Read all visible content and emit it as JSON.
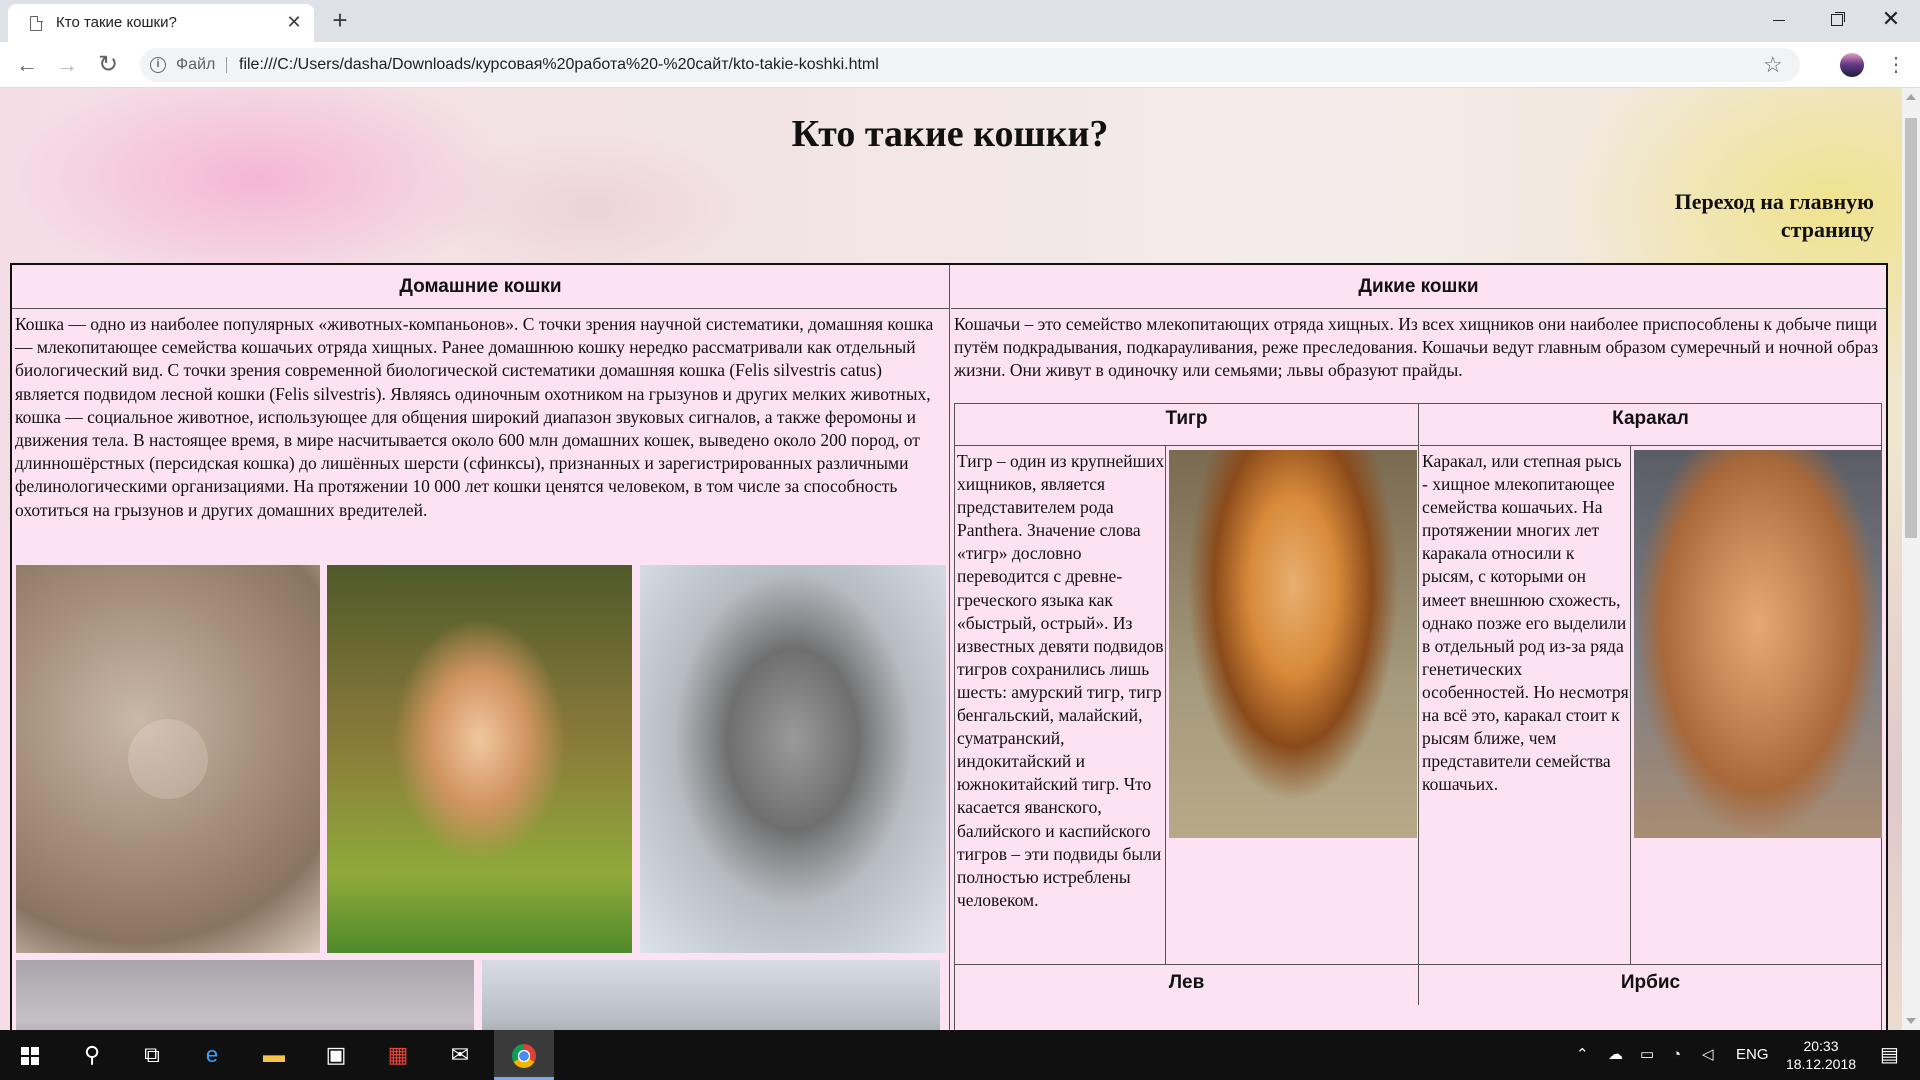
{
  "browser": {
    "tab_title": "Кто такие кошки?",
    "tab_close": "✕",
    "new_tab": "+",
    "scheme_label": "Файл",
    "url": "file:///C:/Users/dasha/Downloads/курсовая%20работа%20-%20сайт/kto-takie-koshki.html",
    "icons": [
      "document-icon",
      "back-icon",
      "forward-icon",
      "reload-icon",
      "info-icon",
      "star-icon",
      "profile-avatar",
      "menu-icon"
    ]
  },
  "page": {
    "title": "Кто такие кошки?",
    "home_link": "Переход на главную страницу",
    "domestic": {
      "heading": "Домашние кошки",
      "text": "Кошка — одно из наиболее популярных «животных-компаньонов». С точки зрения научной систематики, домашняя кошка — млекопитающее семейства кошачьих отряда хищных. Ранее домашнюю кошку нередко рассматривали как отдельный биологический вид. С точки зрения современной биологической систематики домашняя кошка (Felis silvestris catus) является подвидом лесной кошки (Felis silvestris). Являясь одиночным охотником на грызунов и других мелких животных, кошка — социальное животное, использующее для общения широкий диапазон звуковых сигналов, а также феромоны и движения тела. В настоящее время, в мире насчитывается около 600 млн домашних кошек, выведено около 200 пород, от длинношёрстных (персидская кошка) до лишённых шерсти (сфинксы), признанных и зарегистрированных различными фелинологическими организациями. На протяжении 10 000 лет кошки ценятся человеком, в том числе за способность охотиться на грызунов и других домашних вредителей."
    },
    "wild": {
      "heading": "Дикие кошки",
      "text": "Кошачьи – это семейство млекопитающих отряда хищных. Из всех хищников они наиболее приспособлены к добыче пищи путём подкрадывания, подкарауливания, реже преследования. Кошачьи ведут главным образом сумеречный и ночной образ жизни. Они живут в одиночку или семьями; львы образуют прайды.",
      "tiger": {
        "heading": "Тигр",
        "text": "Тигр – один из крупнейших хищников, является представителем рода Panthera. Значение слова «тигр» дословно переводится с древне-греческого языка как «быстрый, острый». Из известных девяти подвидов тигров сохранились лишь шесть: амурский тигр, тигр бенгальский, малайский, суматранский, индокитайский и южнокитайский тигр. Что касается яванского, балийского и каспийского тигров – эти подвиды были полностью истреблены человеком."
      },
      "caracal": {
        "heading": "Каракал",
        "text": "Каракал, или степная рысь - хищное млекопитающее семейства кошачьих. На протяжении многих лет каракала относили к рысям, с которыми он имеет внешнюю схожесть, однако позже его выделили в отдельный род из-за ряда генетических особенностей. Но несмотря на всё это, каракал стоит к рысям ближе, чем представители семейства кошачьих."
      },
      "lion_heading": "Лев",
      "snow_leopard_heading": "Ирбис"
    }
  },
  "taskbar": {
    "language": "ENG",
    "time": "20:33",
    "date": "18.12.2018"
  }
}
